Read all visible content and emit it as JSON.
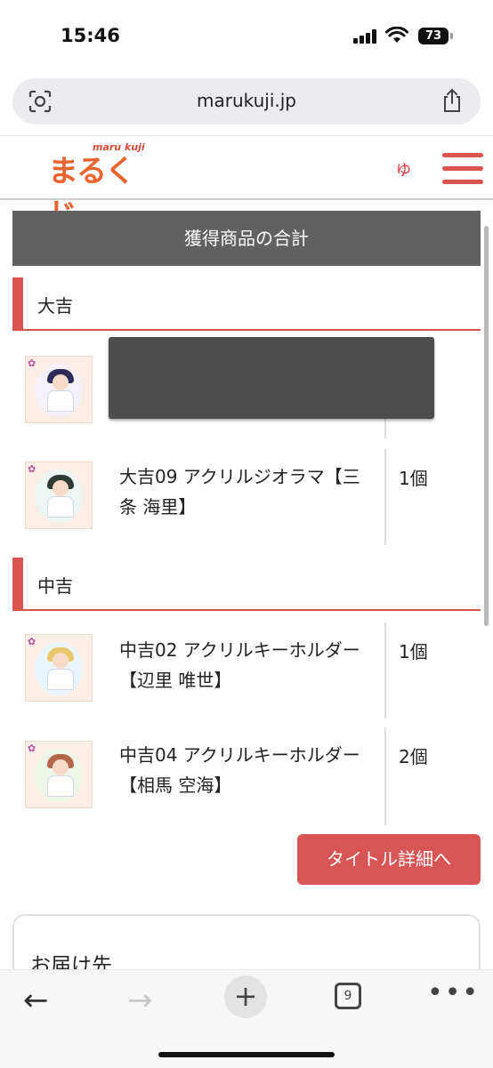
{
  "status_bar": {
    "time": "15:46",
    "battery": "73"
  },
  "browser": {
    "url": "marukuji.jp"
  },
  "site": {
    "logo_kana": "まるくじ",
    "logo_roman": "maru kuji",
    "user_mark": "ゆ"
  },
  "summary": {
    "title": "獲得商品の合計"
  },
  "groups": [
    {
      "grade": "大吉",
      "items": [
        {
          "name": "",
          "qty": ""
        },
        {
          "name": "大吉09 アクリルジオラマ【三条 海里】",
          "qty": "1個"
        }
      ]
    },
    {
      "grade": "中吉",
      "items": [
        {
          "name": "中吉02 アクリルキーホルダー【辺里 唯世】",
          "qty": "1個"
        },
        {
          "name": "中吉04 アクリルキーホルダー【相馬 空海】",
          "qty": "2個"
        }
      ]
    }
  ],
  "detail_button": "タイトル詳細へ",
  "delivery": {
    "title": "お届け先"
  },
  "toolbar": {
    "tabs_count": "9"
  },
  "colors": {
    "accent": "#d9534f",
    "header_bg": "#616161"
  }
}
